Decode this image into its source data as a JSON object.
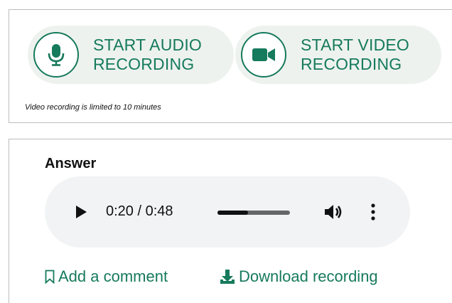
{
  "recording": {
    "audio_button": {
      "line1": "START AUDIO",
      "line2": "RECORDING",
      "icon": "microphone-icon"
    },
    "video_button": {
      "line1": "START VIDEO",
      "line2": "RECORDING",
      "icon": "video-camera-icon"
    },
    "limit_note": "Video recording is limited to 10 minutes"
  },
  "answer": {
    "title": "Answer",
    "player": {
      "current_time": "0:20",
      "separator": " / ",
      "duration": "0:48",
      "progress_fraction": 0.4167
    },
    "add_comment_label": "Add a comment",
    "download_label": "Download recording"
  },
  "colors": {
    "accent": "#167a5c",
    "button_bg": "#edf2ef",
    "player_bg": "#f1f3f4"
  }
}
